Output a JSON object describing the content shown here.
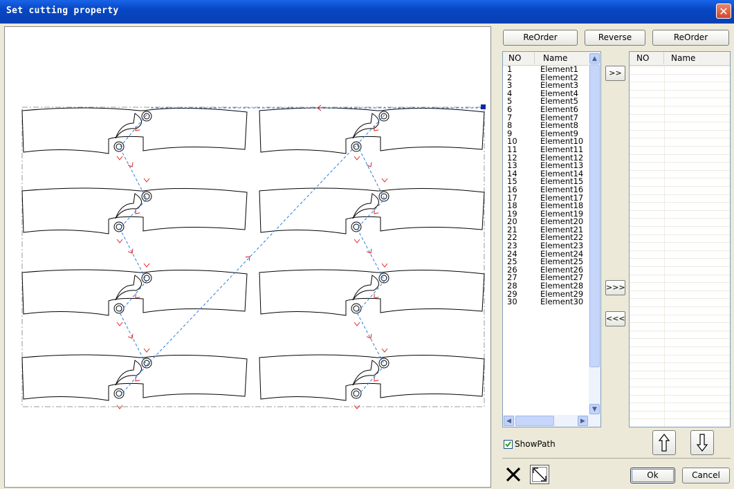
{
  "window": {
    "title": "Set cutting property",
    "close_icon": "close-icon"
  },
  "toolbar": {
    "reorder_left": "ReOrder",
    "reverse": "Reverse",
    "reorder_right": "ReOrder"
  },
  "left_list": {
    "col_no": "NO",
    "col_name": "Name",
    "rows": [
      [
        "1",
        "Element1"
      ],
      [
        "2",
        "Element2"
      ],
      [
        "3",
        "Element3"
      ],
      [
        "4",
        "Element4"
      ],
      [
        "5",
        "Element5"
      ],
      [
        "6",
        "Element6"
      ],
      [
        "7",
        "Element7"
      ],
      [
        "8",
        "Element8"
      ],
      [
        "9",
        "Element9"
      ],
      [
        "10",
        "Element10"
      ],
      [
        "11",
        "Element11"
      ],
      [
        "12",
        "Element12"
      ],
      [
        "13",
        "Element13"
      ],
      [
        "14",
        "Element14"
      ],
      [
        "15",
        "Element15"
      ],
      [
        "16",
        "Element16"
      ],
      [
        "17",
        "Element17"
      ],
      [
        "18",
        "Element18"
      ],
      [
        "19",
        "Element19"
      ],
      [
        "20",
        "Element20"
      ],
      [
        "21",
        "Element21"
      ],
      [
        "22",
        "Element22"
      ],
      [
        "23",
        "Element23"
      ],
      [
        "24",
        "Element24"
      ],
      [
        "25",
        "Element25"
      ],
      [
        "26",
        "Element26"
      ],
      [
        "27",
        "Element27"
      ],
      [
        "28",
        "Element28"
      ],
      [
        "29",
        "Element29"
      ],
      [
        "30",
        "Element30"
      ]
    ]
  },
  "right_list": {
    "col_no": "NO",
    "col_name": "Name"
  },
  "transfer": {
    "move_one": ">>",
    "move_all": ">>>",
    "move_back_all": "<<<"
  },
  "options": {
    "show_path_label": "ShowPath",
    "show_path_checked": true
  },
  "footer": {
    "ok": "Ok",
    "cancel": "Cancel"
  },
  "colors": {
    "title_bar": "#0a4fd6",
    "path_line": "#2e7ad8",
    "arrow": "#e02020",
    "outline": "#000000"
  }
}
